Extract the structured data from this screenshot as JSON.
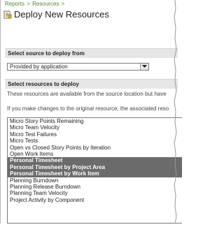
{
  "breadcrumb": {
    "items": [
      "Reports",
      "Resources"
    ],
    "separator": ">"
  },
  "title": "Deploy New Resources",
  "source_section": {
    "header": "Select source to deploy from"
  },
  "source_select": {
    "value": "Provided by application"
  },
  "resources_section": {
    "header": "Select resources to deploy"
  },
  "info_text_1": "These resources are available from the source location but have",
  "info_text_2": "If you make changes to the original resource, the associated reso",
  "resource_list": {
    "items": [
      {
        "label": "Micro Story Points Remaining",
        "selected": false
      },
      {
        "label": "Micro Team Velocity",
        "selected": false
      },
      {
        "label": "Micro Test Failures",
        "selected": false
      },
      {
        "label": "Micro Tests",
        "selected": false
      },
      {
        "label": "Open vs Closed Story Points by Iteration",
        "selected": false
      },
      {
        "label": "Open Work Items",
        "selected": false
      },
      {
        "label": "Personal Timesheet",
        "selected": true
      },
      {
        "label": "Personal Timesheet by Project Area",
        "selected": true
      },
      {
        "label": "Personal Timesheet by Work Item",
        "selected": true
      },
      {
        "label": "Planning Burndown",
        "selected": false
      },
      {
        "label": "Planning Release Burndown",
        "selected": false
      },
      {
        "label": "Planning Team Velocity",
        "selected": false
      },
      {
        "label": "Project Activity by Component",
        "selected": false
      }
    ]
  },
  "colors": {
    "breadcrumb_link": "#4a8a2a",
    "section_header_bg": "#e6e6e6",
    "selected_row_bg": "#6b6b6b"
  }
}
